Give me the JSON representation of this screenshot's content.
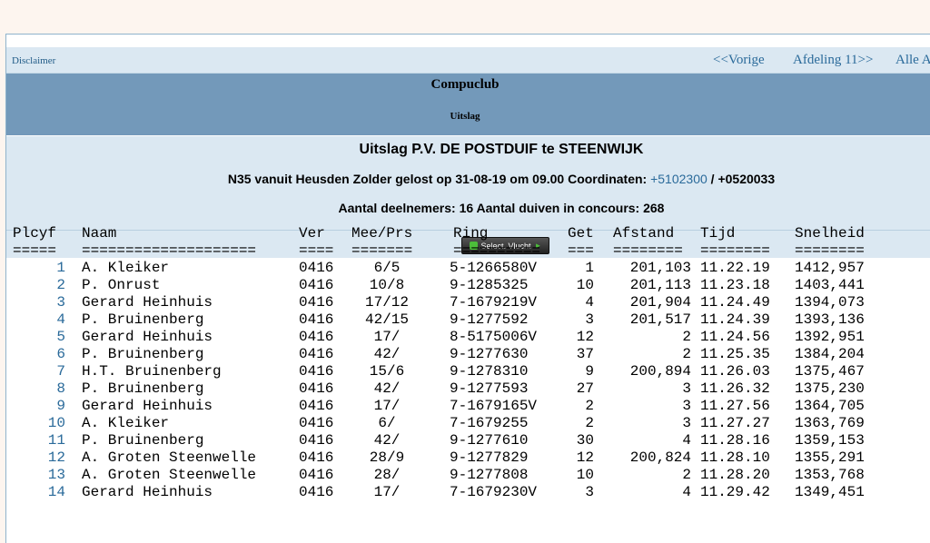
{
  "nav": {
    "disclaimer": "Disclaimer",
    "prev": "<<Vorige",
    "afdeling": "Afdeling 11>>",
    "alle": "Alle A"
  },
  "header": {
    "club": "Compuclub",
    "subtitle": "Uitslag"
  },
  "info": {
    "title": "Uitslag P.V. DE POSTDUIF te STEENWIJK",
    "line_prefix": "N35 vanuit Heusden Zolder gelost op 31-08-19 om 09.00 Coordinaten: ",
    "coord_link": "+5102300",
    "coord_sep": " / ",
    "coord_rest": "+0520033",
    "count": "Aantal deelnemers: 16 Aantal duiven in concours: 268"
  },
  "select_button": "Select. Vlucht",
  "table": {
    "headers": [
      "Plcyf",
      "Naam",
      "Ver",
      "Mee/Prs",
      "Ring",
      "Get",
      "Afstand",
      "Tijd",
      "Snelheid"
    ],
    "separators": [
      "=====",
      "====================",
      "====",
      "=======",
      "==========",
      "===",
      "========",
      "========",
      "========"
    ],
    "rows": [
      [
        "1",
        "A. Kleiker",
        "0416",
        "6/5",
        "5-1266580V",
        "1",
        "201,103",
        "11.22.19",
        "1412,957"
      ],
      [
        "2",
        "P. Onrust",
        "0416",
        "10/8",
        "9-1285325",
        "10",
        "201,113",
        "11.23.18",
        "1403,441"
      ],
      [
        "3",
        "Gerard Heinhuis",
        "0416",
        "17/12",
        "7-1679219V",
        "4",
        "201,904",
        "11.24.49",
        "1394,073"
      ],
      [
        "4",
        "P. Bruinenberg",
        "0416",
        "42/15",
        "9-1277592",
        "3",
        "201,517",
        "11.24.39",
        "1393,136"
      ],
      [
        "5",
        "Gerard Heinhuis",
        "0416",
        "17/",
        "8-5175006V",
        "12",
        "2",
        "11.24.56",
        "1392,951"
      ],
      [
        "6",
        "P. Bruinenberg",
        "0416",
        "42/",
        "9-1277630",
        "37",
        "2",
        "11.25.35",
        "1384,204"
      ],
      [
        "7",
        "H.T. Bruinenberg",
        "0416",
        "15/6",
        "9-1278310",
        "9",
        "200,894",
        "11.26.03",
        "1375,467"
      ],
      [
        "8",
        "P. Bruinenberg",
        "0416",
        "42/",
        "9-1277593",
        "27",
        "3",
        "11.26.32",
        "1375,230"
      ],
      [
        "9",
        "Gerard Heinhuis",
        "0416",
        "17/",
        "7-1679165V",
        "2",
        "3",
        "11.27.56",
        "1364,705"
      ],
      [
        "10",
        "A. Kleiker",
        "0416",
        "6/",
        "7-1679255",
        "2",
        "3",
        "11.27.27",
        "1363,769"
      ],
      [
        "11",
        "P. Bruinenberg",
        "0416",
        "42/",
        "9-1277610",
        "30",
        "4",
        "11.28.16",
        "1359,153"
      ],
      [
        "12",
        "A. Groten Steenwelle",
        "0416",
        "28/9",
        "9-1277829",
        "12",
        "200,824",
        "11.28.10",
        "1355,291"
      ],
      [
        "13",
        "A. Groten Steenwelle",
        "0416",
        "28/",
        "9-1277808",
        "10",
        "2",
        "11.28.20",
        "1353,768"
      ],
      [
        "14",
        "Gerard Heinhuis",
        "0416",
        "17/",
        "7-1679230V",
        "3",
        "4",
        "11.29.42",
        "1349,451"
      ]
    ]
  }
}
